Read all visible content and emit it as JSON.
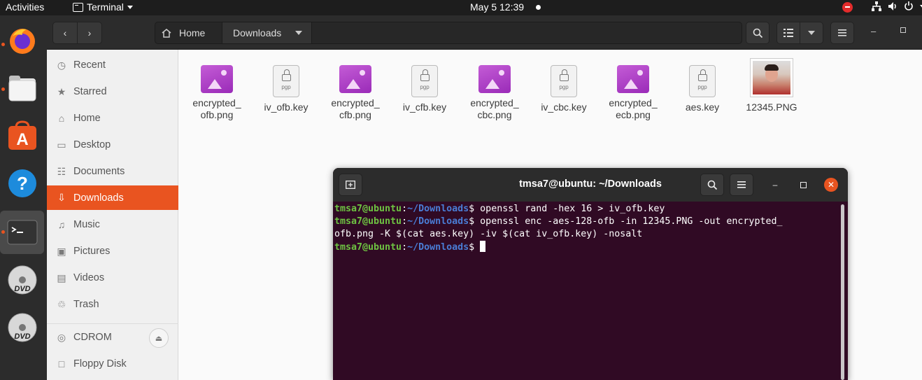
{
  "topbar": {
    "activities": "Activities",
    "app_name": "Terminal",
    "clock": "May 5  12:39"
  },
  "dock": {
    "items": [
      {
        "name": "firefox-icon"
      },
      {
        "name": "files-icon"
      },
      {
        "name": "software-icon"
      },
      {
        "name": "help-icon"
      },
      {
        "name": "terminal-icon"
      },
      {
        "name": "dvd-icon"
      },
      {
        "name": "dvd-icon"
      }
    ]
  },
  "file_manager": {
    "path": {
      "home": "Home",
      "current": "Downloads"
    },
    "sidebar": [
      {
        "label": "Recent",
        "icon": "clock-icon"
      },
      {
        "label": "Starred",
        "icon": "star-icon"
      },
      {
        "label": "Home",
        "icon": "home-icon"
      },
      {
        "label": "Desktop",
        "icon": "desktop-icon"
      },
      {
        "label": "Documents",
        "icon": "document-icon"
      },
      {
        "label": "Downloads",
        "icon": "download-icon"
      },
      {
        "label": "Music",
        "icon": "music-icon"
      },
      {
        "label": "Pictures",
        "icon": "pictures-icon"
      },
      {
        "label": "Videos",
        "icon": "videos-icon"
      },
      {
        "label": "Trash",
        "icon": "trash-icon"
      },
      {
        "label": "CDROM",
        "icon": "disc-icon"
      },
      {
        "label": "Floppy Disk",
        "icon": "floppy-icon"
      }
    ],
    "files": [
      {
        "line1": "encrypted_",
        "line2": "ofb.png",
        "type": "image"
      },
      {
        "line1": "iv_ofb.key",
        "line2": "",
        "type": "key"
      },
      {
        "line1": "encrypted_",
        "line2": "cfb.png",
        "type": "image"
      },
      {
        "line1": "iv_cfb.key",
        "line2": "",
        "type": "key"
      },
      {
        "line1": "encrypted_",
        "line2": "cbc.png",
        "type": "image"
      },
      {
        "line1": "iv_cbc.key",
        "line2": "",
        "type": "key"
      },
      {
        "line1": "encrypted_",
        "line2": "ecb.png",
        "type": "image"
      },
      {
        "line1": "aes.key",
        "line2": "",
        "type": "key"
      },
      {
        "line1": "12345.PNG",
        "line2": "",
        "type": "photo"
      }
    ],
    "key_badge": "pgp"
  },
  "terminal": {
    "title": "tmsa7@ubuntu: ~/Downloads",
    "prompt_user": "tmsa7@ubuntu",
    "prompt_sep": ":",
    "prompt_path": "~/Downloads",
    "prompt_dollar": "$",
    "commands": [
      " openssl rand -hex 16 > iv_ofb.key",
      " openssl enc -aes-128-ofb -in 12345.PNG -out encrypted_"
    ],
    "wrap_line": "ofb.png -K $(cat aes.key) -iv $(cat iv_ofb.key) -nosalt"
  }
}
